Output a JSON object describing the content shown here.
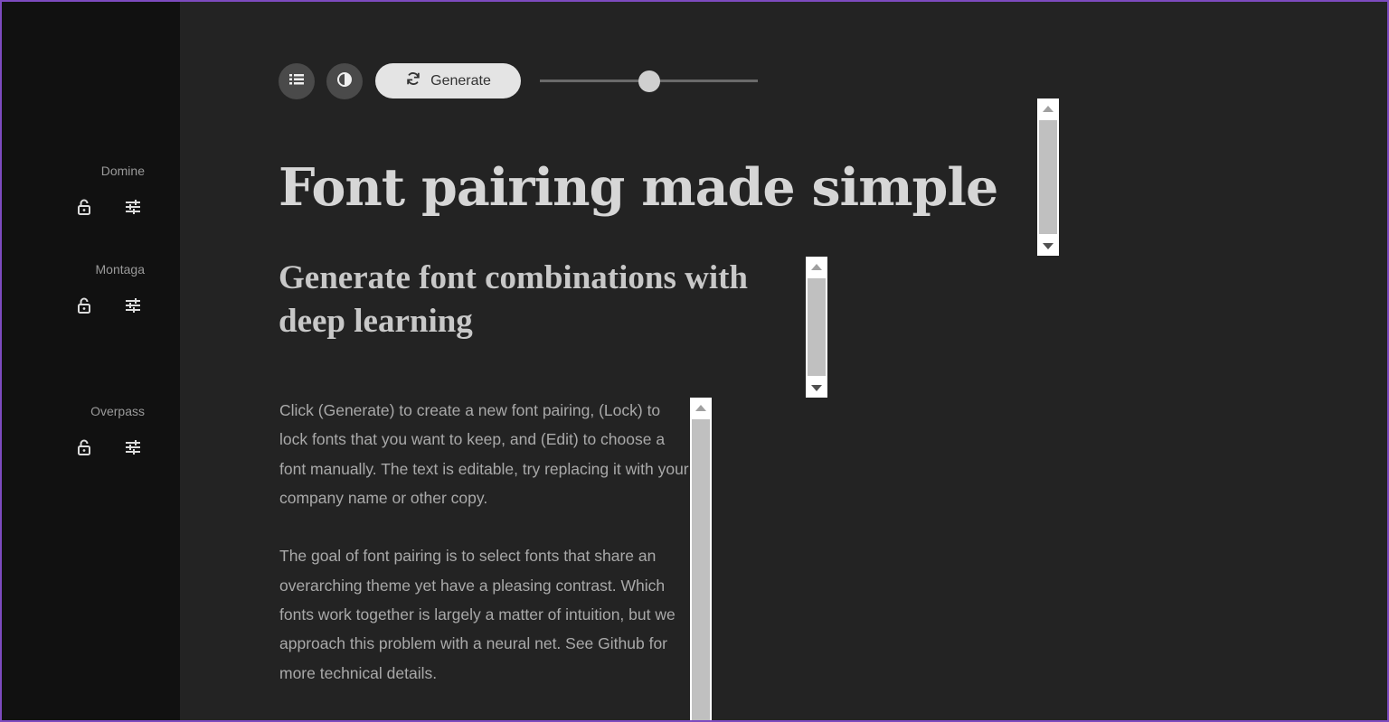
{
  "sidebar": {
    "fonts": [
      {
        "name": "Domine",
        "lock_icon": "lock-icon",
        "edit_icon": "sliders-icon"
      },
      {
        "name": "Montaga",
        "lock_icon": "lock-icon",
        "edit_icon": "sliders-icon"
      },
      {
        "name": "Overpass",
        "lock_icon": "lock-icon",
        "edit_icon": "sliders-icon"
      }
    ]
  },
  "toolbar": {
    "list_icon": "list-icon",
    "contrast_icon": "contrast-icon",
    "generate_icon": "refresh-icon",
    "generate_label": "Generate",
    "slider_level": 0.5
  },
  "content": {
    "headline": "Font pairing made simple",
    "subhead": "Generate font combinations with deep learning",
    "paragraphs": [
      "Click (Generate) to create a new font pairing, (Lock) to lock fonts that you want to keep, and (Edit) to choose a font manually. The text is editable, try replacing it with your company name or other copy.",
      "The goal of font pairing is to select fonts that share an overarching theme yet have a pleasing contrast. Which fonts work together is largely a matter of intuition, but we approach this problem with a neural net. See Github for more technical details."
    ]
  },
  "colors": {
    "background": "#232323",
    "sidebar": "#111111",
    "accent_border": "#7d4bbf",
    "generate_button": "#e4e4e4"
  }
}
